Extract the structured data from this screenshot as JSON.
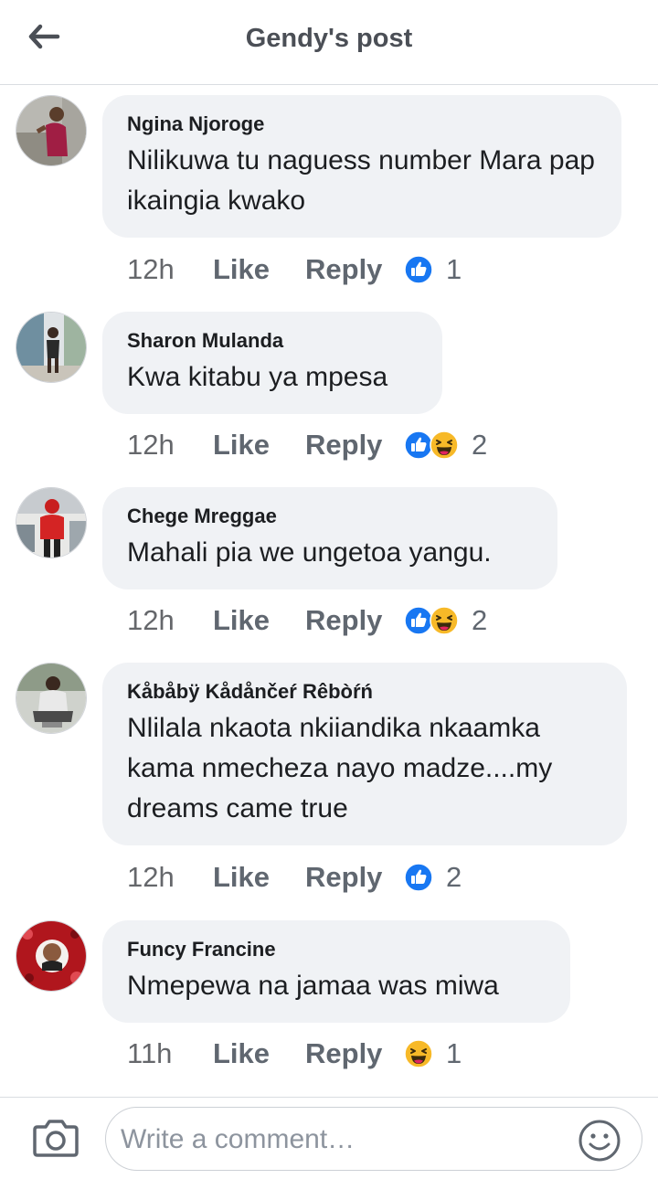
{
  "header": {
    "title": "Gendy's post",
    "back_icon": "arrow-left-icon"
  },
  "comments": [
    {
      "author": "Ngina Njoroge",
      "text": "Nilikuwa tu naguess number Mara pap ikaingia kwako",
      "time": "12h",
      "like_label": "Like",
      "reply_label": "Reply",
      "reactions": [
        "like"
      ],
      "reaction_count": "1"
    },
    {
      "author": "Sharon Mulanda",
      "text": "Kwa kitabu ya mpesa",
      "time": "12h",
      "like_label": "Like",
      "reply_label": "Reply",
      "reactions": [
        "like",
        "haha"
      ],
      "reaction_count": "2"
    },
    {
      "author": "Chege Mreggae",
      "text": "Mahali pia we ungetoa yangu.",
      "time": "12h",
      "like_label": "Like",
      "reply_label": "Reply",
      "reactions": [
        "like",
        "haha"
      ],
      "reaction_count": "2"
    },
    {
      "author": "Kåbåbÿ Kådånčeŕ Rêbòŕń",
      "text": "Nlilala nkaota nkiiandika nkaamka kama nmecheza nayo madze....my dreams came true",
      "time": "12h",
      "like_label": "Like",
      "reply_label": "Reply",
      "reactions": [
        "like"
      ],
      "reaction_count": "2"
    },
    {
      "author": "Funcy Francine",
      "text": "Nmepewa na jamaa was miwa",
      "time": "11h",
      "like_label": "Like",
      "reply_label": "Reply",
      "reactions": [
        "haha"
      ],
      "reaction_count": "1"
    }
  ],
  "composer": {
    "placeholder": "Write a comment…",
    "camera_icon": "camera-icon",
    "emoji_icon": "emoji-icon"
  },
  "colors": {
    "like_blue": "#1877f2",
    "haha_yellow": "#f7b928",
    "bubble_bg": "#f0f2f5",
    "meta_gray": "#606770"
  }
}
